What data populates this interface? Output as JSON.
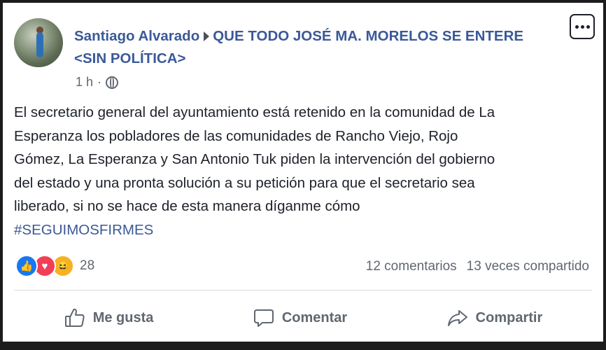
{
  "post": {
    "author": "Santiago Alvarado",
    "group": "QUE TODO JOSÉ MA. MORELOS SE ENTERE <SIN POLÍTICA>",
    "time": "1 h",
    "separator": "·",
    "body_line1": "El secretario general del ayuntamiento está retenido en la comunidad de La",
    "body_line2": "Esperanza los pobladores de las comunidades de Rancho Viejo, Rojo",
    "body_line3": "Gómez, La Esperanza y San Antonio Tuk piden la intervención del gobierno",
    "body_line4": "del estado y una pronta solución a su petición para que el secretario sea",
    "body_line5": "liberado, si no se hace de esta manera díganme cómo",
    "hashtag": "#SEGUIMOSFIRMES"
  },
  "reactions": {
    "count": "28",
    "like_symbol": "👍",
    "love_symbol": "♥",
    "haha_symbol": "😆"
  },
  "stats": {
    "comments": "12 comentarios",
    "shares": "13 veces compartido"
  },
  "actions": {
    "like": "Me gusta",
    "comment": "Comentar",
    "share": "Compartir"
  },
  "colors": {
    "link_blue": "#3b5998",
    "text_gray": "#616770",
    "body_text": "#1d2129"
  },
  "icons": [
    "globe-icon",
    "more-options-icon",
    "like-icon",
    "comment-icon",
    "share-icon"
  ]
}
